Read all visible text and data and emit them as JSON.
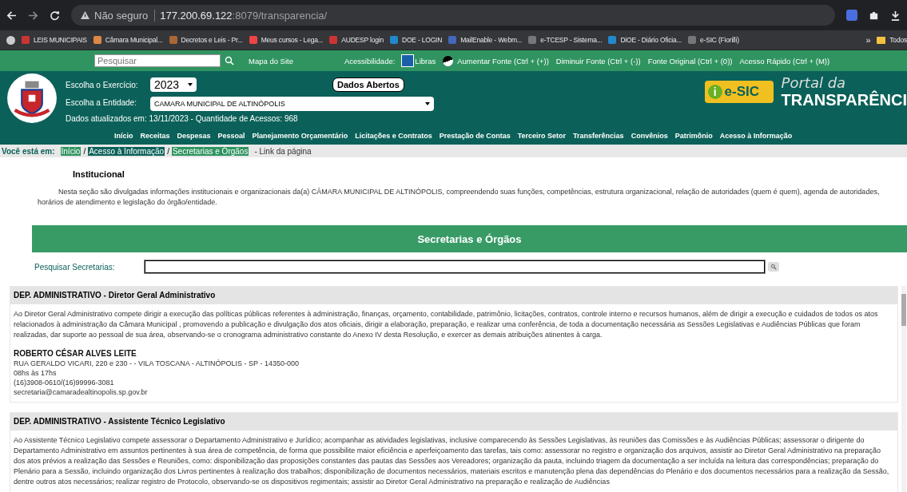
{
  "browser": {
    "security": "Não seguro",
    "host": "177.200.69.122",
    "path": ":8079/transparencia/",
    "bookmarks": [
      {
        "label": "LEIS MUNICIPAIS"
      },
      {
        "label": "Câmara Municipal..."
      },
      {
        "label": "Decretos e Leis - Pr..."
      },
      {
        "label": "Meus cursos - Lega..."
      },
      {
        "label": "AUDESP login"
      },
      {
        "label": "DOE - LOGIN"
      },
      {
        "label": "MailEnable - Webm..."
      },
      {
        "label": "e-TCESP - Sistema..."
      },
      {
        "label": "DiOE - Diário Oficia..."
      },
      {
        "label": "e-SIC (Fiorilli)"
      }
    ],
    "overflow": "»",
    "folder": "Todos"
  },
  "topbar": {
    "search_placeholder": "Pesquisar",
    "sitemap": "Mapa do Site",
    "accessibility_label": "Acessibilidade:",
    "links": [
      "Libras",
      "Aumentar Fonte (Ctrl + (+))",
      "Diminuir Fonte (Ctrl + (-))",
      "Fonte Original (Ctrl + (0))",
      "Acesso Rápido (Ctrl + (M))"
    ]
  },
  "header": {
    "year_label": "Escolha o Exercício:",
    "year": "2023",
    "entity_label": "Escolha a Entidade:",
    "entity": "CAMARA MUNICIPAL DE ALTINÓPOLIS",
    "open_data": "Dados Abertos",
    "updated": "Dados atualizados em: 13/11/2023 - Quantidade de Acessos: 968",
    "esic_mark": "i",
    "esic": "e-SIC",
    "portal_small": "Portal da",
    "portal_big": "TRANSPARÊNCI"
  },
  "nav": [
    "Início",
    "Receitas",
    "Despesas",
    "Pessoal",
    "Planejamento Orçamentário",
    "Licitações e Contratos",
    "Prestação de Contas",
    "Terceiro Setor",
    "Transferências",
    "Convênios",
    "Patrimônio",
    "Acesso à Informação"
  ],
  "breadcrumb": {
    "label": "Você está em:",
    "items": [
      {
        "label": "Início",
        "kind": "green"
      },
      {
        "label": "Acesso à Informação",
        "kind": "teal"
      },
      {
        "label": "Secretarias e Órgãos",
        "kind": "green"
      }
    ],
    "separator": "/",
    "tail": "- Link da página"
  },
  "intro": {
    "title": "Institucional",
    "text": "Nesta seção são divulgadas informações institucionais e organizacionais da(a) CÂMARA MUNICIPAL DE ALTINÓPOLIS, compreendendo suas funções, competências, estrutura organizacional, relação de autoridades (quem é quem), agenda de autoridades, horários de atendimento e legislação do órgão/entidade."
  },
  "section": {
    "title": "Secretarias e Órgãos",
    "search_label": "Pesquisar Secretarias:"
  },
  "cards": [
    {
      "department": "DEP. ADMINISTRATIVO",
      "role": "- Diretor Geral Administrativo",
      "description": "Ao Diretor Geral Administrativo compete dirigir a execução das políticas públicas referentes à administração, finanças, orçamento, contabilidade, patrimônio, licitações, contratos, controle interno e recursos humanos, além de dirigir a execução e cuidados de todos os atos relacionados à administração da Câmara Municipal , promovendo a publicação e divulgação dos atos oficiais, dirigir a elaboração, preparação, e realizar uma conferência, de toda a documentação necessária as Sessões Legislativas e Audiências Públicas que foram realizadas, dar suporte ao pessoal de sua área, observando-se o cronograma administrativo constante do Anexo IV desta Resolução, e exercer as demais atribuições atinentes à carga.",
      "name": "ROBERTO CÉSAR ALVES LEITE",
      "details": [
        "RUA GERALDO VICARI, 220 e 230 - - VILA TOSCANA - ALTINÓPOLIS - SP - 14350-000",
        "08hs às 17hs",
        "(16)3908-0610/(16)99996-3081",
        "secretaria@camaradealtinopolis.sp.gov.br"
      ]
    },
    {
      "department": "DEP. ADMINISTRATIVO",
      "role": "- Assistente Técnico Legislativo",
      "description": "Ao Assistente Técnico Legislativo compete assessorar o Departamento Administrativo e Jurídico; acompanhar as atividades legislativas, inclusive comparecendo às Sessões Legislativas, às reuniões das Comissões e às Audiências Públicas; assessorar o dirigente do Departamento Administrativo em assuntos pertinentes à sua área de competência, de forma que possibilite maior eficiência e aperfeiçoamento das tarefas, tais como: assessorar no registro e organização dos arquivos, assistir ao Diretor Geral Administrativo na preparação dos atos prévios a realização das Sessões e Reuniões, como: disponibilização das proposições constantes das pautas das Sessões aos Vereadores; organização da pauta, incluindo triagem da documentação a ser incluída na leitura das correspondências; preparação do Plenário para a Sessão, incluindo organização dos Livros pertinentes à realização dos trabalhos; disponibilização de documentos necessários, materiais escritos e manutenção plena das dependências do Plenário e dos documentos necessários para a realização da Sessão, dentre outros atos necessários; realizar registro de Protocolo, observando-se os dispositivos regimentais; assistir ao Diretor Geral Administrativo na preparação e realização de Audiências"
    }
  ]
}
